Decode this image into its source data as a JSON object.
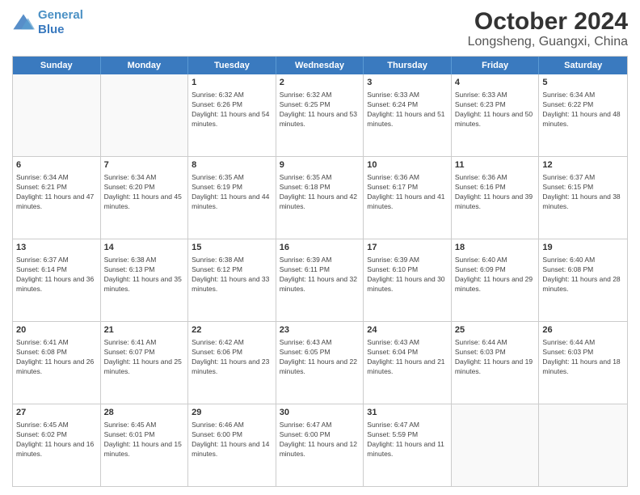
{
  "header": {
    "logo_line1": "General",
    "logo_line2": "Blue",
    "month": "October 2024",
    "location": "Longsheng, Guangxi, China"
  },
  "days_of_week": [
    "Sunday",
    "Monday",
    "Tuesday",
    "Wednesday",
    "Thursday",
    "Friday",
    "Saturday"
  ],
  "weeks": [
    [
      {
        "day": "",
        "empty": true
      },
      {
        "day": "",
        "empty": true
      },
      {
        "day": "1",
        "sunrise": "Sunrise: 6:32 AM",
        "sunset": "Sunset: 6:26 PM",
        "daylight": "Daylight: 11 hours and 54 minutes."
      },
      {
        "day": "2",
        "sunrise": "Sunrise: 6:32 AM",
        "sunset": "Sunset: 6:25 PM",
        "daylight": "Daylight: 11 hours and 53 minutes."
      },
      {
        "day": "3",
        "sunrise": "Sunrise: 6:33 AM",
        "sunset": "Sunset: 6:24 PM",
        "daylight": "Daylight: 11 hours and 51 minutes."
      },
      {
        "day": "4",
        "sunrise": "Sunrise: 6:33 AM",
        "sunset": "Sunset: 6:23 PM",
        "daylight": "Daylight: 11 hours and 50 minutes."
      },
      {
        "day": "5",
        "sunrise": "Sunrise: 6:34 AM",
        "sunset": "Sunset: 6:22 PM",
        "daylight": "Daylight: 11 hours and 48 minutes."
      }
    ],
    [
      {
        "day": "6",
        "sunrise": "Sunrise: 6:34 AM",
        "sunset": "Sunset: 6:21 PM",
        "daylight": "Daylight: 11 hours and 47 minutes."
      },
      {
        "day": "7",
        "sunrise": "Sunrise: 6:34 AM",
        "sunset": "Sunset: 6:20 PM",
        "daylight": "Daylight: 11 hours and 45 minutes."
      },
      {
        "day": "8",
        "sunrise": "Sunrise: 6:35 AM",
        "sunset": "Sunset: 6:19 PM",
        "daylight": "Daylight: 11 hours and 44 minutes."
      },
      {
        "day": "9",
        "sunrise": "Sunrise: 6:35 AM",
        "sunset": "Sunset: 6:18 PM",
        "daylight": "Daylight: 11 hours and 42 minutes."
      },
      {
        "day": "10",
        "sunrise": "Sunrise: 6:36 AM",
        "sunset": "Sunset: 6:17 PM",
        "daylight": "Daylight: 11 hours and 41 minutes."
      },
      {
        "day": "11",
        "sunrise": "Sunrise: 6:36 AM",
        "sunset": "Sunset: 6:16 PM",
        "daylight": "Daylight: 11 hours and 39 minutes."
      },
      {
        "day": "12",
        "sunrise": "Sunrise: 6:37 AM",
        "sunset": "Sunset: 6:15 PM",
        "daylight": "Daylight: 11 hours and 38 minutes."
      }
    ],
    [
      {
        "day": "13",
        "sunrise": "Sunrise: 6:37 AM",
        "sunset": "Sunset: 6:14 PM",
        "daylight": "Daylight: 11 hours and 36 minutes."
      },
      {
        "day": "14",
        "sunrise": "Sunrise: 6:38 AM",
        "sunset": "Sunset: 6:13 PM",
        "daylight": "Daylight: 11 hours and 35 minutes."
      },
      {
        "day": "15",
        "sunrise": "Sunrise: 6:38 AM",
        "sunset": "Sunset: 6:12 PM",
        "daylight": "Daylight: 11 hours and 33 minutes."
      },
      {
        "day": "16",
        "sunrise": "Sunrise: 6:39 AM",
        "sunset": "Sunset: 6:11 PM",
        "daylight": "Daylight: 11 hours and 32 minutes."
      },
      {
        "day": "17",
        "sunrise": "Sunrise: 6:39 AM",
        "sunset": "Sunset: 6:10 PM",
        "daylight": "Daylight: 11 hours and 30 minutes."
      },
      {
        "day": "18",
        "sunrise": "Sunrise: 6:40 AM",
        "sunset": "Sunset: 6:09 PM",
        "daylight": "Daylight: 11 hours and 29 minutes."
      },
      {
        "day": "19",
        "sunrise": "Sunrise: 6:40 AM",
        "sunset": "Sunset: 6:08 PM",
        "daylight": "Daylight: 11 hours and 28 minutes."
      }
    ],
    [
      {
        "day": "20",
        "sunrise": "Sunrise: 6:41 AM",
        "sunset": "Sunset: 6:08 PM",
        "daylight": "Daylight: 11 hours and 26 minutes."
      },
      {
        "day": "21",
        "sunrise": "Sunrise: 6:41 AM",
        "sunset": "Sunset: 6:07 PM",
        "daylight": "Daylight: 11 hours and 25 minutes."
      },
      {
        "day": "22",
        "sunrise": "Sunrise: 6:42 AM",
        "sunset": "Sunset: 6:06 PM",
        "daylight": "Daylight: 11 hours and 23 minutes."
      },
      {
        "day": "23",
        "sunrise": "Sunrise: 6:43 AM",
        "sunset": "Sunset: 6:05 PM",
        "daylight": "Daylight: 11 hours and 22 minutes."
      },
      {
        "day": "24",
        "sunrise": "Sunrise: 6:43 AM",
        "sunset": "Sunset: 6:04 PM",
        "daylight": "Daylight: 11 hours and 21 minutes."
      },
      {
        "day": "25",
        "sunrise": "Sunrise: 6:44 AM",
        "sunset": "Sunset: 6:03 PM",
        "daylight": "Daylight: 11 hours and 19 minutes."
      },
      {
        "day": "26",
        "sunrise": "Sunrise: 6:44 AM",
        "sunset": "Sunset: 6:03 PM",
        "daylight": "Daylight: 11 hours and 18 minutes."
      }
    ],
    [
      {
        "day": "27",
        "sunrise": "Sunrise: 6:45 AM",
        "sunset": "Sunset: 6:02 PM",
        "daylight": "Daylight: 11 hours and 16 minutes."
      },
      {
        "day": "28",
        "sunrise": "Sunrise: 6:45 AM",
        "sunset": "Sunset: 6:01 PM",
        "daylight": "Daylight: 11 hours and 15 minutes."
      },
      {
        "day": "29",
        "sunrise": "Sunrise: 6:46 AM",
        "sunset": "Sunset: 6:00 PM",
        "daylight": "Daylight: 11 hours and 14 minutes."
      },
      {
        "day": "30",
        "sunrise": "Sunrise: 6:47 AM",
        "sunset": "Sunset: 6:00 PM",
        "daylight": "Daylight: 11 hours and 12 minutes."
      },
      {
        "day": "31",
        "sunrise": "Sunrise: 6:47 AM",
        "sunset": "Sunset: 5:59 PM",
        "daylight": "Daylight: 11 hours and 11 minutes."
      },
      {
        "day": "",
        "empty": true
      },
      {
        "day": "",
        "empty": true
      }
    ]
  ]
}
